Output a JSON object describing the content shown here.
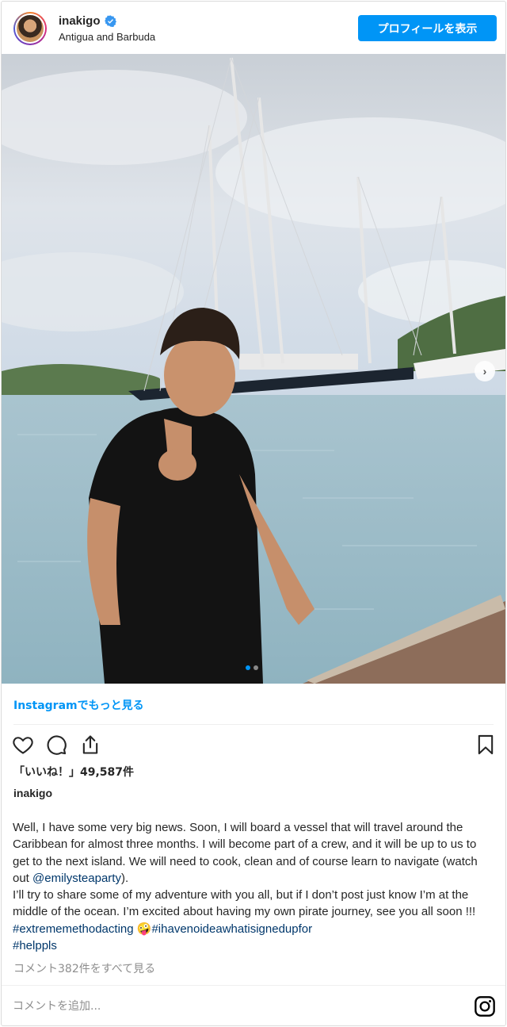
{
  "header": {
    "username": "inakigo",
    "location": "Antigua and Barbuda",
    "profile_button": "プロフィールを表示",
    "verified": true
  },
  "post": {
    "photo_alt": "",
    "carousel_index": 1,
    "carousel_count": 2
  },
  "more_link": "Instagramでもっと見る",
  "likes": "「いいね！」49,587件",
  "caption": {
    "username": "inakigo",
    "text_1": "Well, I have some very big news. Soon, I will board a vessel that will travel around the Caribbean for almost three months. I will become part of a crew, and it will be up to us to get to the next island. We will need to cook, clean and of course learn to navigate (watch out ",
    "mention": "@emilysteaparty",
    "text_2": ").\nI’ll try to share some of my adventure with you all, but if I don’t post just know I’m at the middle of the ocean. I’m excited about having my own pirate journey, see you all soon !!! ",
    "hashtag_1": "#extrememethodacting",
    "emoji": "🤪",
    "hashtag_2": "#ihavenoideawhatisignedupfor",
    "hashtag_3": "#helppls"
  },
  "view_comments": "コメント382件をすべて見る",
  "comment_placeholder": "コメントを追加...",
  "icons": {
    "like": "heart-icon",
    "comment": "comment-bubble-icon",
    "share": "share-icon",
    "save": "bookmark-icon",
    "instagram": "instagram-logo-icon",
    "next": "chevron-right-icon"
  },
  "colors": {
    "accent": "#0095f6",
    "link": "#00376b",
    "muted": "#8e8e8e"
  }
}
